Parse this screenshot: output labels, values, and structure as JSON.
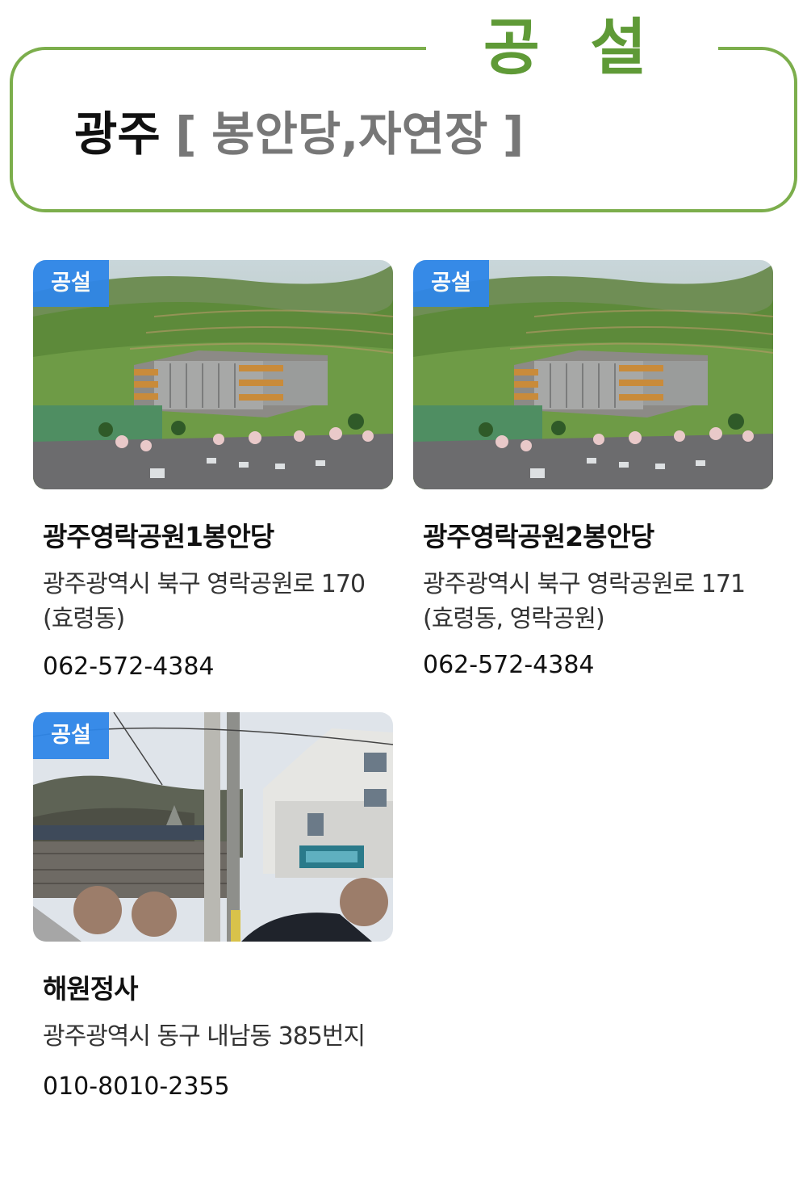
{
  "section": {
    "title": "공 설"
  },
  "region": {
    "name": "광주",
    "open_bracket": "[",
    "sub": "봉안당,자연장",
    "close_bracket": "]"
  },
  "colors": {
    "accent_green": "#7cae4c",
    "title_green": "#5f9a37",
    "badge_blue": "#2f86e8"
  },
  "cards": [
    {
      "badge": "공설",
      "image": "cemetery-building-rendering",
      "title": "광주영락공원1봉안당",
      "address": "광주광역시 북구 영락공원로 170 (효령동)",
      "phone": "062-572-4384"
    },
    {
      "badge": "공설",
      "image": "cemetery-building-rendering",
      "title": "광주영락공원2봉안당",
      "address": "광주광역시 북구 영락공원로 171 (효령동, 영락공원)",
      "phone": "062-572-4384"
    },
    {
      "badge": "공설",
      "image": "temple-street-photo",
      "title": "해원정사",
      "address": "광주광역시 동구 내남동 385번지",
      "phone": "010-8010-2355"
    }
  ]
}
